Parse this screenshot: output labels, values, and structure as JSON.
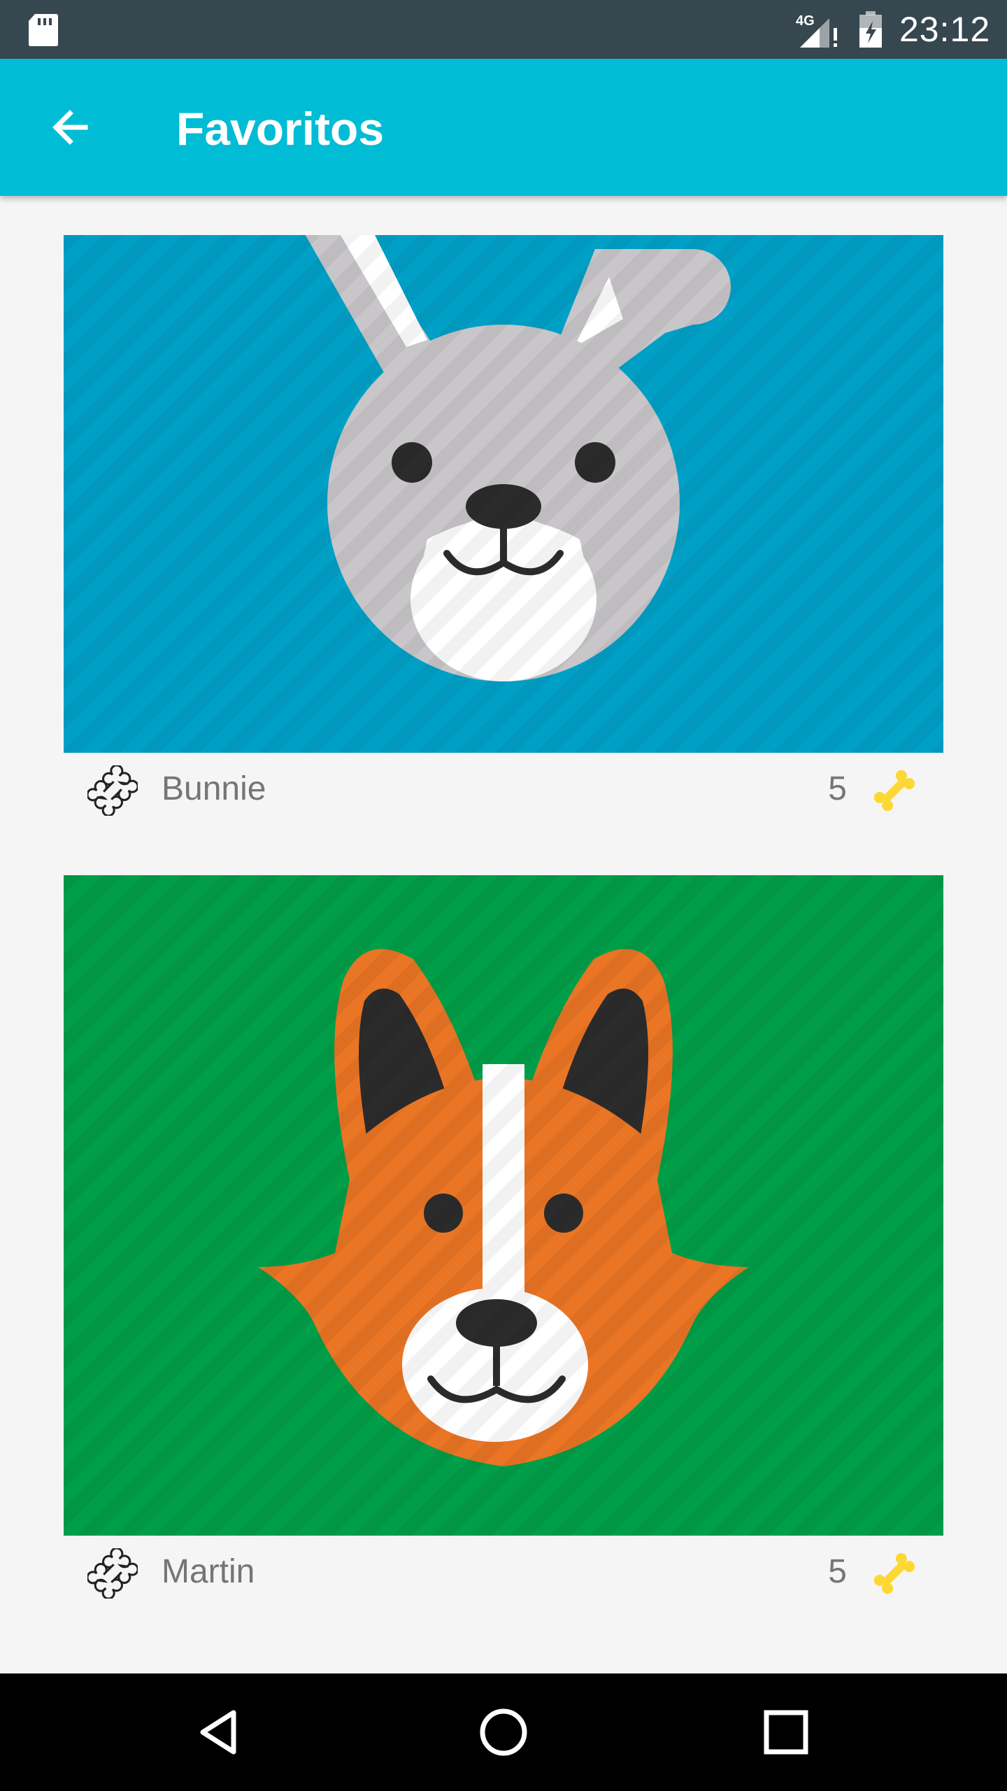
{
  "status_bar": {
    "time": "23:12",
    "network": "4G",
    "icons": [
      "sd-card-icon",
      "signal-4g-icon",
      "battery-icon"
    ]
  },
  "app_bar": {
    "title": "Favoritos",
    "back_icon": "arrow-back-icon",
    "color": "#00bcd4"
  },
  "favorites": [
    {
      "name": "Bunnie",
      "likes": "5",
      "image": "rabbit-illustration",
      "background": "#00a0c6",
      "rate_icon": "bone-outline-icon",
      "likes_icon": "bone-filled-icon"
    },
    {
      "name": "Martin",
      "likes": "5",
      "image": "corgi-dog-illustration",
      "background": "#009e48",
      "rate_icon": "bone-outline-icon",
      "likes_icon": "bone-filled-icon"
    }
  ],
  "nav_bar": {
    "buttons": [
      "back-triangle-icon",
      "home-circle-icon",
      "recents-square-icon"
    ]
  },
  "colors": {
    "status_bar": "#37474f",
    "bone_filled": "#fdd835",
    "text_secondary": "#757575"
  }
}
